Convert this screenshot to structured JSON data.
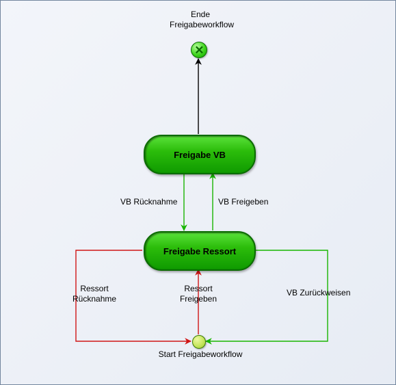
{
  "diagram": {
    "title_top": "Ende",
    "title_top2": "Freigabeworkflow",
    "node_vb": "Freigabe VB",
    "node_ressort": "Freigabe Ressort",
    "start_label": "Start Freigabeworkflow",
    "edge_vb_rueck": "VB Rücknahme",
    "edge_vb_frei": "VB Freigeben",
    "edge_ressort_rueck_l1": "Ressort",
    "edge_ressort_rueck_l2": "Rücknahme",
    "edge_ressort_frei_l1": "Ressort",
    "edge_ressort_frei_l2": "Freigeben",
    "edge_vb_zurueck": "VB Zurückweisen",
    "end_glyph": "✕"
  },
  "colors": {
    "red": "#d01515",
    "green": "#18b500",
    "black": "#000000"
  },
  "chart_data": {
    "type": "state-workflow",
    "nodes": [
      {
        "id": "end",
        "type": "end",
        "label": "Ende Freigabeworkflow"
      },
      {
        "id": "vb",
        "type": "state",
        "label": "Freigabe VB"
      },
      {
        "id": "ressort",
        "type": "state",
        "label": "Freigabe Ressort"
      },
      {
        "id": "start",
        "type": "start",
        "label": "Start Freigabeworkflow"
      }
    ],
    "edges": [
      {
        "from": "vb",
        "to": "end",
        "label": "",
        "color": "black"
      },
      {
        "from": "ressort",
        "to": "vb",
        "label": "VB Freigeben",
        "color": "green"
      },
      {
        "from": "vb",
        "to": "ressort",
        "label": "VB Rücknahme",
        "color": "green"
      },
      {
        "from": "start",
        "to": "ressort",
        "label": "Ressort Freigeben",
        "color": "red"
      },
      {
        "from": "ressort",
        "to": "start",
        "label": "Ressort Rücknahme",
        "color": "red"
      },
      {
        "from": "vb",
        "to": "start",
        "label": "VB Zurückweisen",
        "color": "green",
        "via": "right"
      }
    ]
  }
}
